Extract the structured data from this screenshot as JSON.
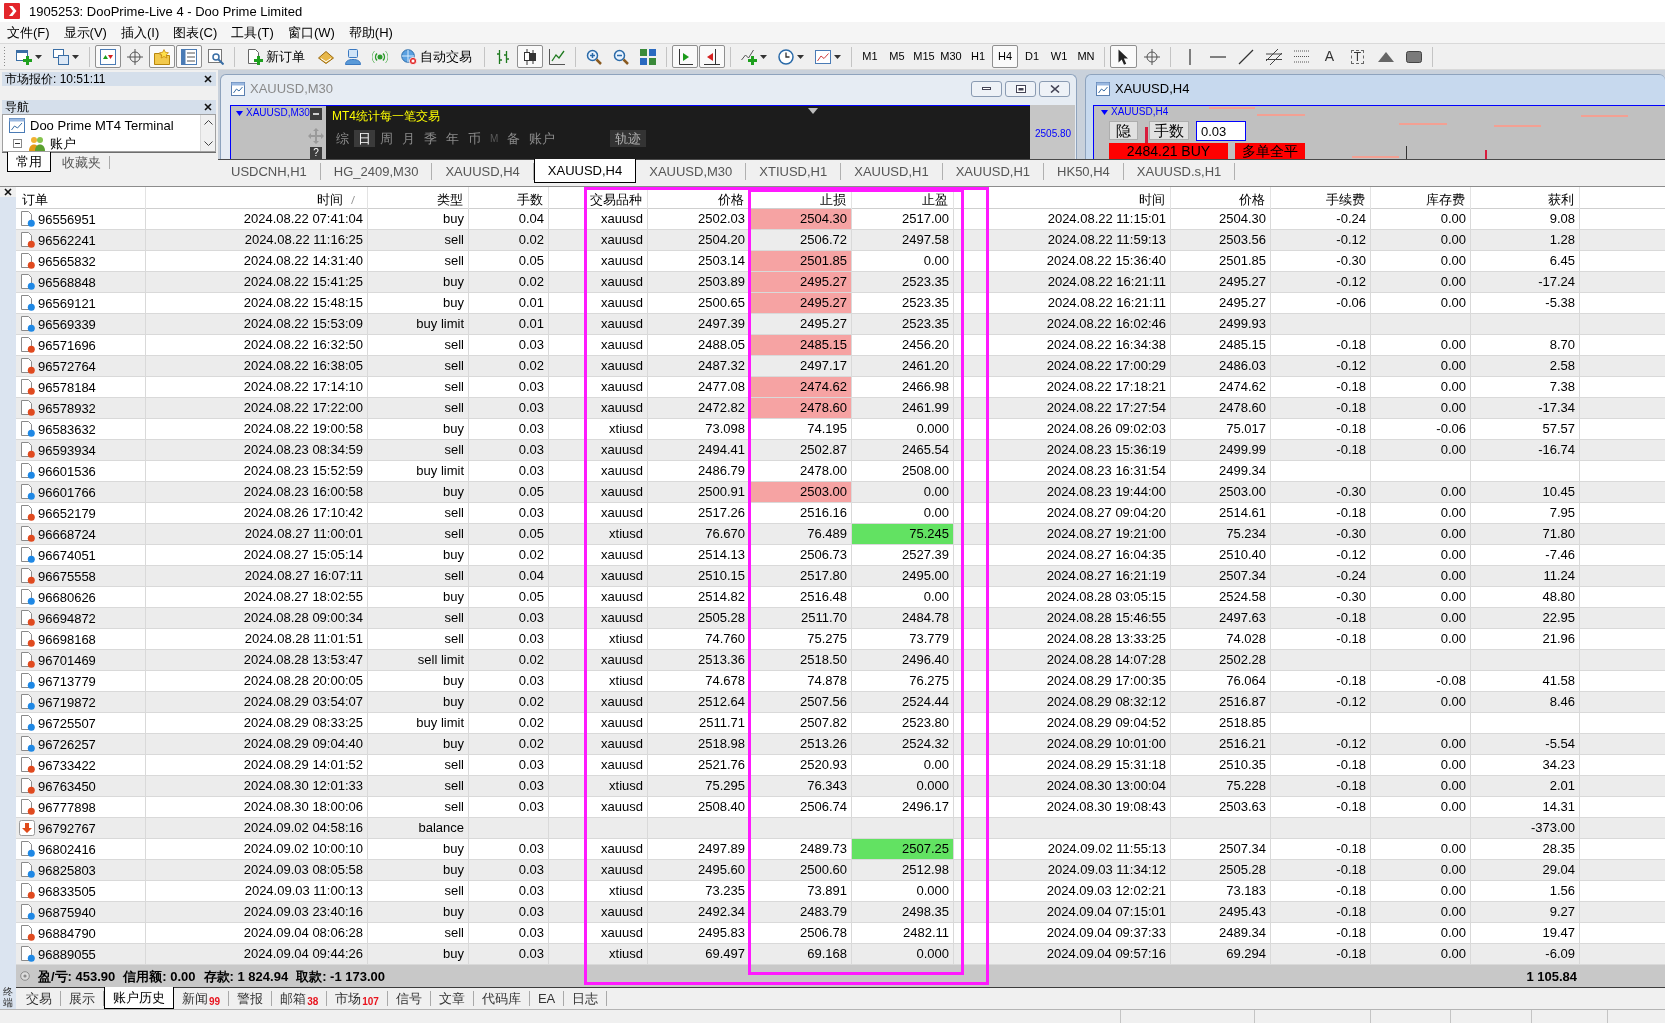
{
  "window": {
    "title": "1905253: DooPrime-Live 4 - Doo Prime Limited"
  },
  "menu": [
    "文件(F)",
    "显示(V)",
    "插入(I)",
    "图表(C)",
    "工具(T)",
    "窗口(W)",
    "帮助(H)"
  ],
  "toolbar": {
    "view_toggles": [
      {
        "kind": "market_watch",
        "on": true
      },
      {
        "kind": "data_window",
        "on": false
      },
      {
        "kind": "navigator",
        "on": true
      },
      {
        "kind": "terminal",
        "on": true
      },
      {
        "kind": "tester",
        "on": false
      }
    ],
    "new_order": "新订单",
    "auto_trading": "自动交易",
    "chart_types": [
      {
        "kind": "bars",
        "selected": false
      },
      {
        "kind": "candles",
        "selected": true
      },
      {
        "kind": "line",
        "selected": false
      }
    ],
    "chart_toggles": [
      {
        "kind": "auto_scroll",
        "on": true
      },
      {
        "kind": "chart_shift",
        "on": true
      }
    ],
    "timeframes": [
      {
        "label": "M1",
        "selected": false
      },
      {
        "label": "M5",
        "selected": false
      },
      {
        "label": "M15",
        "selected": false
      },
      {
        "label": "M30",
        "selected": false
      },
      {
        "label": "H1",
        "selected": false
      },
      {
        "label": "H4",
        "selected": true
      },
      {
        "label": "D1",
        "selected": false
      },
      {
        "label": "W1",
        "selected": false
      },
      {
        "label": "MN",
        "selected": false
      }
    ],
    "tools": [
      {
        "kind": "cursor",
        "selected": true
      },
      {
        "kind": "crosshair",
        "selected": false
      },
      {
        "kind": "vertical_line",
        "selected": false
      },
      {
        "kind": "horizontal_line",
        "selected": false
      },
      {
        "kind": "trend_line",
        "selected": false
      },
      {
        "kind": "fibonacci",
        "selected": false
      },
      {
        "kind": "channel",
        "selected": false
      },
      {
        "kind": "text",
        "glyph": "A",
        "selected": false
      },
      {
        "kind": "label",
        "glyph": "T",
        "selected": false
      },
      {
        "kind": "arrow",
        "selected": false
      },
      {
        "kind": "rectangle",
        "selected": false
      }
    ]
  },
  "market_watch": {
    "title": "市场报价: 10:51:11"
  },
  "navigator": {
    "title": "导航",
    "tree": [
      {
        "label": "Doo Prime MT4 Terminal",
        "children": [
          {
            "label": "账户",
            "expanded": true
          }
        ]
      }
    ],
    "tabs": [
      {
        "label": "常用",
        "selected": true
      },
      {
        "label": "收藏夹",
        "selected": false
      }
    ]
  },
  "chart_windows": [
    {
      "kind": "stats_panel",
      "title": "XAUUSD,M30",
      "active": false,
      "symbol_label": "XAUUSD,M30",
      "panel_title": "MT4统计每一笔交易",
      "periods": [
        {
          "label": "综",
          "selected": false,
          "disabled": false
        },
        {
          "label": "日",
          "selected": true,
          "disabled": false
        },
        {
          "label": "周",
          "selected": false,
          "disabled": false
        },
        {
          "label": "月",
          "selected": false,
          "disabled": false
        },
        {
          "label": "季",
          "selected": false,
          "disabled": false
        },
        {
          "label": "年",
          "selected": false,
          "disabled": false
        },
        {
          "label": "币",
          "selected": false,
          "disabled": false
        },
        {
          "label": "M",
          "selected": false,
          "disabled": true
        },
        {
          "label": "备",
          "selected": false,
          "disabled": false
        },
        {
          "label": "账户",
          "selected": false,
          "disabled": false
        }
      ],
      "trace_button": "轨迹",
      "help_button": "?",
      "price_label": "2505.80"
    },
    {
      "kind": "trade_panel",
      "title": "XAUUSD,H4",
      "active": true,
      "symbol_label": "XAUUSD,H4",
      "hide_button": "隐",
      "lots_label": "手数",
      "lots_value": "0.03",
      "buy_button": "2484.21 BUY",
      "close_all_button": "多单全平"
    }
  ],
  "chart_tabs": [
    {
      "label": "USDCNH,H1",
      "selected": false
    },
    {
      "label": "HG_2409,M30",
      "selected": false
    },
    {
      "label": "XAUUSD,H4",
      "selected": false
    },
    {
      "label": "XAUUSD,H4",
      "selected": true
    },
    {
      "label": "XAUUSD,M30",
      "selected": false
    },
    {
      "label": "XTIUSD,H1",
      "selected": false
    },
    {
      "label": "XAUUSD,H1",
      "selected": false
    },
    {
      "label": "XAUUSD,H1",
      "selected": false
    },
    {
      "label": "HK50,H4",
      "selected": false
    },
    {
      "label": "XAUUSD.s,H1",
      "selected": false
    }
  ],
  "terminal": {
    "label": "终端",
    "columns": [
      {
        "label": "订单",
        "sorted": false
      },
      {
        "label": "时间",
        "sorted": true
      },
      {
        "label": "类型",
        "sorted": false
      },
      {
        "label": "手数",
        "sorted": false
      },
      {
        "label": "交易品种",
        "sorted": false
      },
      {
        "label": "价格",
        "sorted": false
      },
      {
        "label": "止损",
        "sorted": false
      },
      {
        "label": "止盈",
        "sorted": false
      },
      {
        "label": "时间",
        "sorted": false
      },
      {
        "label": "价格",
        "sorted": false
      },
      {
        "label": "手续费",
        "sorted": false
      },
      {
        "label": "库存费",
        "sorted": false
      },
      {
        "label": "获利",
        "sorted": false
      }
    ],
    "rows": [
      {
        "order": "96556951",
        "kind": "buy",
        "time": "2024.08.22 07:41:04",
        "type": "buy",
        "lots": "0.04",
        "symbol": "xauusd",
        "price": "2502.03",
        "sl": "2504.30",
        "tp": "2517.00",
        "close_time": "2024.08.22 11:15:01",
        "close_price": "2504.30",
        "commission": "-0.24",
        "swap": "0.00",
        "profit": "9.08",
        "sl_hit": true,
        "tp_hit": false
      },
      {
        "order": "96562241",
        "kind": "sell",
        "time": "2024.08.22 11:16:25",
        "type": "sell",
        "lots": "0.02",
        "symbol": "xauusd",
        "price": "2504.20",
        "sl": "2506.72",
        "tp": "2497.58",
        "close_time": "2024.08.22 11:59:13",
        "close_price": "2503.56",
        "commission": "-0.12",
        "swap": "0.00",
        "profit": "1.28",
        "sl_hit": false,
        "tp_hit": false
      },
      {
        "order": "96565832",
        "kind": "sell",
        "time": "2024.08.22 14:31:40",
        "type": "sell",
        "lots": "0.05",
        "symbol": "xauusd",
        "price": "2503.14",
        "sl": "2501.85",
        "tp": "0.00",
        "close_time": "2024.08.22 15:36:40",
        "close_price": "2501.85",
        "commission": "-0.30",
        "swap": "0.00",
        "profit": "6.45",
        "sl_hit": true,
        "tp_hit": false
      },
      {
        "order": "96568848",
        "kind": "buy",
        "time": "2024.08.22 15:41:25",
        "type": "buy",
        "lots": "0.02",
        "symbol": "xauusd",
        "price": "2503.89",
        "sl": "2495.27",
        "tp": "2523.35",
        "close_time": "2024.08.22 16:21:11",
        "close_price": "2495.27",
        "commission": "-0.12",
        "swap": "0.00",
        "profit": "-17.24",
        "sl_hit": true,
        "tp_hit": false
      },
      {
        "order": "96569121",
        "kind": "buy",
        "time": "2024.08.22 15:48:15",
        "type": "buy",
        "lots": "0.01",
        "symbol": "xauusd",
        "price": "2500.65",
        "sl": "2495.27",
        "tp": "2523.35",
        "close_time": "2024.08.22 16:21:11",
        "close_price": "2495.27",
        "commission": "-0.06",
        "swap": "0.00",
        "profit": "-5.38",
        "sl_hit": true,
        "tp_hit": false
      },
      {
        "order": "96569339",
        "kind": "buy",
        "time": "2024.08.22 15:53:09",
        "type": "buy limit",
        "lots": "0.01",
        "symbol": "xauusd",
        "price": "2497.39",
        "sl": "2495.27",
        "tp": "2523.35",
        "close_time": "2024.08.22 16:02:46",
        "close_price": "2499.93",
        "sl_hit": false,
        "tp_hit": false
      },
      {
        "order": "96571696",
        "kind": "sell",
        "time": "2024.08.22 16:32:50",
        "type": "sell",
        "lots": "0.03",
        "symbol": "xauusd",
        "price": "2488.05",
        "sl": "2485.15",
        "tp": "2456.20",
        "close_time": "2024.08.22 16:34:38",
        "close_price": "2485.15",
        "commission": "-0.18",
        "swap": "0.00",
        "profit": "8.70",
        "sl_hit": true,
        "tp_hit": false
      },
      {
        "order": "96572764",
        "kind": "sell",
        "time": "2024.08.22 16:38:05",
        "type": "sell",
        "lots": "0.02",
        "symbol": "xauusd",
        "price": "2487.32",
        "sl": "2497.17",
        "tp": "2461.20",
        "close_time": "2024.08.22 17:00:29",
        "close_price": "2486.03",
        "commission": "-0.12",
        "swap": "0.00",
        "profit": "2.58",
        "sl_hit": false,
        "tp_hit": false
      },
      {
        "order": "96578184",
        "kind": "sell",
        "time": "2024.08.22 17:14:10",
        "type": "sell",
        "lots": "0.03",
        "symbol": "xauusd",
        "price": "2477.08",
        "sl": "2474.62",
        "tp": "2466.98",
        "close_time": "2024.08.22 17:18:21",
        "close_price": "2474.62",
        "commission": "-0.18",
        "swap": "0.00",
        "profit": "7.38",
        "sl_hit": true,
        "tp_hit": false
      },
      {
        "order": "96578932",
        "kind": "sell",
        "time": "2024.08.22 17:22:00",
        "type": "sell",
        "lots": "0.03",
        "symbol": "xauusd",
        "price": "2472.82",
        "sl": "2478.60",
        "tp": "2461.99",
        "close_time": "2024.08.22 17:27:54",
        "close_price": "2478.60",
        "commission": "-0.18",
        "swap": "0.00",
        "profit": "-17.34",
        "sl_hit": true,
        "tp_hit": false
      },
      {
        "order": "96583632",
        "kind": "buy",
        "time": "2024.08.22 19:00:58",
        "type": "buy",
        "lots": "0.03",
        "symbol": "xtiusd",
        "price": "73.098",
        "sl": "74.195",
        "tp": "0.000",
        "close_time": "2024.08.26 09:02:03",
        "close_price": "75.017",
        "commission": "-0.18",
        "swap": "-0.06",
        "profit": "57.57",
        "sl_hit": false,
        "tp_hit": false
      },
      {
        "order": "96593934",
        "kind": "sell",
        "time": "2024.08.23 08:34:59",
        "type": "sell",
        "lots": "0.03",
        "symbol": "xauusd",
        "price": "2494.41",
        "sl": "2502.87",
        "tp": "2465.54",
        "close_time": "2024.08.23 15:36:19",
        "close_price": "2499.99",
        "commission": "-0.18",
        "swap": "0.00",
        "profit": "-16.74",
        "sl_hit": false,
        "tp_hit": false
      },
      {
        "order": "96601536",
        "kind": "buy",
        "time": "2024.08.23 15:52:59",
        "type": "buy limit",
        "lots": "0.03",
        "symbol": "xauusd",
        "price": "2486.79",
        "sl": "2478.00",
        "tp": "2508.00",
        "close_time": "2024.08.23 16:31:54",
        "close_price": "2499.34",
        "sl_hit": false,
        "tp_hit": false
      },
      {
        "order": "96601766",
        "kind": "buy",
        "time": "2024.08.23 16:00:58",
        "type": "buy",
        "lots": "0.05",
        "symbol": "xauusd",
        "price": "2500.91",
        "sl": "2503.00",
        "tp": "0.00",
        "close_time": "2024.08.23 19:44:00",
        "close_price": "2503.00",
        "commission": "-0.30",
        "swap": "0.00",
        "profit": "10.45",
        "sl_hit": true,
        "tp_hit": false
      },
      {
        "order": "96652179",
        "kind": "sell",
        "time": "2024.08.26 17:10:42",
        "type": "sell",
        "lots": "0.03",
        "symbol": "xauusd",
        "price": "2517.26",
        "sl": "2516.16",
        "tp": "0.00",
        "close_time": "2024.08.27 09:04:20",
        "close_price": "2514.61",
        "commission": "-0.18",
        "swap": "0.00",
        "profit": "7.95",
        "sl_hit": false,
        "tp_hit": false
      },
      {
        "order": "96668724",
        "kind": "sell",
        "time": "2024.08.27 11:00:01",
        "type": "sell",
        "lots": "0.05",
        "symbol": "xtiusd",
        "price": "76.670",
        "sl": "76.489",
        "tp": "75.245",
        "close_time": "2024.08.27 19:21:00",
        "close_price": "75.234",
        "commission": "-0.30",
        "swap": "0.00",
        "profit": "71.80",
        "sl_hit": false,
        "tp_hit": true
      },
      {
        "order": "96674051",
        "kind": "buy",
        "time": "2024.08.27 15:05:14",
        "type": "buy",
        "lots": "0.02",
        "symbol": "xauusd",
        "price": "2514.13",
        "sl": "2506.73",
        "tp": "2527.39",
        "close_time": "2024.08.27 16:04:35",
        "close_price": "2510.40",
        "commission": "-0.12",
        "swap": "0.00",
        "profit": "-7.46",
        "sl_hit": false,
        "tp_hit": false
      },
      {
        "order": "96675558",
        "kind": "sell",
        "time": "2024.08.27 16:07:11",
        "type": "sell",
        "lots": "0.04",
        "symbol": "xauusd",
        "price": "2510.15",
        "sl": "2517.80",
        "tp": "2495.00",
        "close_time": "2024.08.27 16:21:19",
        "close_price": "2507.34",
        "commission": "-0.24",
        "swap": "0.00",
        "profit": "11.24",
        "sl_hit": false,
        "tp_hit": false
      },
      {
        "order": "96680626",
        "kind": "buy",
        "time": "2024.08.27 18:02:55",
        "type": "buy",
        "lots": "0.05",
        "symbol": "xauusd",
        "price": "2514.82",
        "sl": "2516.48",
        "tp": "0.00",
        "close_time": "2024.08.28 03:05:15",
        "close_price": "2524.58",
        "commission": "-0.30",
        "swap": "0.00",
        "profit": "48.80",
        "sl_hit": false,
        "tp_hit": false
      },
      {
        "order": "96694872",
        "kind": "sell",
        "time": "2024.08.28 09:00:34",
        "type": "sell",
        "lots": "0.03",
        "symbol": "xauusd",
        "price": "2505.28",
        "sl": "2511.70",
        "tp": "2484.78",
        "close_time": "2024.08.28 15:46:55",
        "close_price": "2497.63",
        "commission": "-0.18",
        "swap": "0.00",
        "profit": "22.95",
        "sl_hit": false,
        "tp_hit": false
      },
      {
        "order": "96698168",
        "kind": "sell",
        "time": "2024.08.28 11:01:51",
        "type": "sell",
        "lots": "0.03",
        "symbol": "xtiusd",
        "price": "74.760",
        "sl": "75.275",
        "tp": "73.779",
        "close_time": "2024.08.28 13:33:25",
        "close_price": "74.028",
        "commission": "-0.18",
        "swap": "0.00",
        "profit": "21.96",
        "sl_hit": false,
        "tp_hit": false
      },
      {
        "order": "96701469",
        "kind": "sell",
        "time": "2024.08.28 13:53:47",
        "type": "sell limit",
        "lots": "0.02",
        "symbol": "xauusd",
        "price": "2513.36",
        "sl": "2518.50",
        "tp": "2496.40",
        "close_time": "2024.08.28 14:07:28",
        "close_price": "2502.28",
        "sl_hit": false,
        "tp_hit": false
      },
      {
        "order": "96713779",
        "kind": "buy",
        "time": "2024.08.28 20:00:05",
        "type": "buy",
        "lots": "0.03",
        "symbol": "xtiusd",
        "price": "74.678",
        "sl": "74.878",
        "tp": "76.275",
        "close_time": "2024.08.29 17:00:35",
        "close_price": "76.064",
        "commission": "-0.18",
        "swap": "-0.08",
        "profit": "41.58",
        "sl_hit": false,
        "tp_hit": false
      },
      {
        "order": "96719872",
        "kind": "buy",
        "time": "2024.08.29 03:54:07",
        "type": "buy",
        "lots": "0.02",
        "symbol": "xauusd",
        "price": "2512.64",
        "sl": "2507.56",
        "tp": "2524.44",
        "close_time": "2024.08.29 08:32:12",
        "close_price": "2516.87",
        "commission": "-0.12",
        "swap": "0.00",
        "profit": "8.46",
        "sl_hit": false,
        "tp_hit": false
      },
      {
        "order": "96725507",
        "kind": "buy",
        "time": "2024.08.29 08:33:25",
        "type": "buy limit",
        "lots": "0.02",
        "symbol": "xauusd",
        "price": "2511.71",
        "sl": "2507.82",
        "tp": "2523.80",
        "close_time": "2024.08.29 09:04:52",
        "close_price": "2518.85",
        "sl_hit": false,
        "tp_hit": false
      },
      {
        "order": "96726257",
        "kind": "buy",
        "time": "2024.08.29 09:04:40",
        "type": "buy",
        "lots": "0.02",
        "symbol": "xauusd",
        "price": "2518.98",
        "sl": "2513.26",
        "tp": "2524.32",
        "close_time": "2024.08.29 10:01:00",
        "close_price": "2516.21",
        "commission": "-0.12",
        "swap": "0.00",
        "profit": "-5.54",
        "sl_hit": false,
        "tp_hit": false
      },
      {
        "order": "96733422",
        "kind": "sell",
        "time": "2024.08.29 14:01:52",
        "type": "sell",
        "lots": "0.03",
        "symbol": "xauusd",
        "price": "2521.76",
        "sl": "2520.93",
        "tp": "0.00",
        "close_time": "2024.08.29 15:31:18",
        "close_price": "2510.35",
        "commission": "-0.18",
        "swap": "0.00",
        "profit": "34.23",
        "sl_hit": false,
        "tp_hit": false
      },
      {
        "order": "96763450",
        "kind": "sell",
        "time": "2024.08.30 12:01:33",
        "type": "sell",
        "lots": "0.03",
        "symbol": "xtiusd",
        "price": "75.295",
        "sl": "76.343",
        "tp": "0.000",
        "close_time": "2024.08.30 13:00:04",
        "close_price": "75.228",
        "commission": "-0.18",
        "swap": "0.00",
        "profit": "2.01",
        "sl_hit": false,
        "tp_hit": false
      },
      {
        "order": "96777898",
        "kind": "sell",
        "time": "2024.08.30 18:00:06",
        "type": "sell",
        "lots": "0.03",
        "symbol": "xauusd",
        "price": "2508.40",
        "sl": "2506.74",
        "tp": "2496.17",
        "close_time": "2024.08.30 19:08:43",
        "close_price": "2503.63",
        "commission": "-0.18",
        "swap": "0.00",
        "profit": "14.31",
        "sl_hit": false,
        "tp_hit": false
      },
      {
        "order": "96792767",
        "kind": "balance",
        "time": "2024.09.02 04:58:16",
        "type": "balance",
        "profit": "-373.00",
        "sl_hit": false,
        "tp_hit": false
      },
      {
        "order": "96802416",
        "kind": "buy",
        "time": "2024.09.02 10:00:10",
        "type": "buy",
        "lots": "0.03",
        "symbol": "xauusd",
        "price": "2497.89",
        "sl": "2489.73",
        "tp": "2507.25",
        "close_time": "2024.09.02 11:55:13",
        "close_price": "2507.34",
        "commission": "-0.18",
        "swap": "0.00",
        "profit": "28.35",
        "sl_hit": false,
        "tp_hit": true
      },
      {
        "order": "96825803",
        "kind": "buy",
        "time": "2024.09.03 08:05:58",
        "type": "buy",
        "lots": "0.03",
        "symbol": "xauusd",
        "price": "2495.60",
        "sl": "2500.60",
        "tp": "2512.98",
        "close_time": "2024.09.03 11:34:12",
        "close_price": "2505.28",
        "commission": "-0.18",
        "swap": "0.00",
        "profit": "29.04",
        "sl_hit": false,
        "tp_hit": false
      },
      {
        "order": "96833505",
        "kind": "sell",
        "time": "2024.09.03 11:00:13",
        "type": "sell",
        "lots": "0.03",
        "symbol": "xtiusd",
        "price": "73.235",
        "sl": "73.891",
        "tp": "0.000",
        "close_time": "2024.09.03 12:02:21",
        "close_price": "73.183",
        "commission": "-0.18",
        "swap": "0.00",
        "profit": "1.56",
        "sl_hit": false,
        "tp_hit": false
      },
      {
        "order": "96875940",
        "kind": "buy",
        "time": "2024.09.03 23:40:16",
        "type": "buy",
        "lots": "0.03",
        "symbol": "xauusd",
        "price": "2492.34",
        "sl": "2483.79",
        "tp": "2498.35",
        "close_time": "2024.09.04 07:15:01",
        "close_price": "2495.43",
        "commission": "-0.18",
        "swap": "0.00",
        "profit": "9.27",
        "sl_hit": false,
        "tp_hit": false
      },
      {
        "order": "96884790",
        "kind": "sell",
        "time": "2024.09.04 08:06:28",
        "type": "sell",
        "lots": "0.03",
        "symbol": "xauusd",
        "price": "2495.83",
        "sl": "2506.78",
        "tp": "2482.11",
        "close_time": "2024.09.04 09:37:33",
        "close_price": "2489.34",
        "commission": "-0.18",
        "swap": "0.00",
        "profit": "19.47",
        "sl_hit": false,
        "tp_hit": false
      },
      {
        "order": "96889055",
        "kind": "buy",
        "time": "2024.09.04 09:44:26",
        "type": "buy",
        "lots": "0.03",
        "symbol": "xtiusd",
        "price": "69.497",
        "sl": "69.168",
        "tp": "0.000",
        "close_time": "2024.09.04 09:57:16",
        "close_price": "69.294",
        "commission": "-0.18",
        "swap": "0.00",
        "profit": "-6.09",
        "sl_hit": false,
        "tp_hit": false
      }
    ],
    "summary": {
      "items": [
        "盈/亏: 453.90",
        "信用额: 0.00",
        "存款: 1 824.94",
        "取款: -1 173.00"
      ],
      "total": "1 105.84"
    },
    "tabs": [
      {
        "label": "交易",
        "selected": false
      },
      {
        "label": "展示",
        "selected": false
      },
      {
        "label": "账户历史",
        "selected": true
      },
      {
        "label": "新闻",
        "count": "99",
        "selected": false
      },
      {
        "label": "警报",
        "selected": false
      },
      {
        "label": "邮箱",
        "count": "38",
        "selected": false
      },
      {
        "label": "市场",
        "count": "107",
        "selected": false
      },
      {
        "label": "信号",
        "selected": false
      },
      {
        "label": "文章",
        "selected": false
      },
      {
        "label": "代码库",
        "selected": false
      },
      {
        "label": "EA",
        "selected": false
      },
      {
        "label": "日志",
        "selected": false
      }
    ]
  }
}
